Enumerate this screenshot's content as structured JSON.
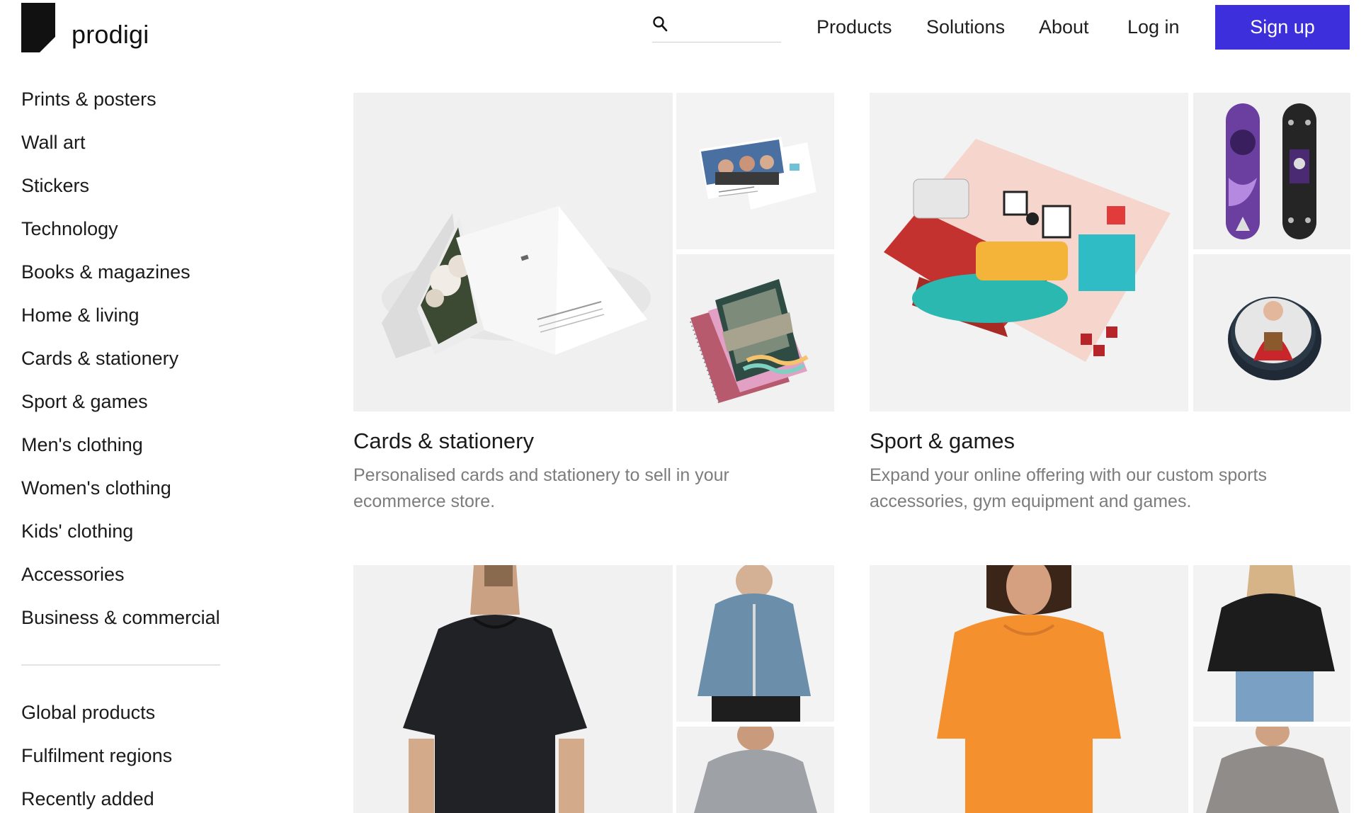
{
  "header": {
    "logo_text": "prodigi",
    "search": {
      "placeholder": "",
      "value": ""
    },
    "nav": {
      "products": "Products",
      "solutions": "Solutions",
      "about": "About",
      "login": "Log in"
    },
    "signup_label": "Sign up",
    "colors": {
      "signup_bg": "#3d2fdb"
    }
  },
  "sidebar": {
    "items": [
      {
        "label": "Prints & posters"
      },
      {
        "label": "Wall art"
      },
      {
        "label": "Stickers"
      },
      {
        "label": "Technology"
      },
      {
        "label": "Books & magazines"
      },
      {
        "label": "Home & living"
      },
      {
        "label": "Cards & stationery"
      },
      {
        "label": "Sport & games"
      },
      {
        "label": "Men's clothing"
      },
      {
        "label": "Women's clothing"
      },
      {
        "label": "Kids' clothing"
      },
      {
        "label": "Accessories"
      },
      {
        "label": "Business & commercial"
      }
    ],
    "secondary": [
      {
        "label": "Global products"
      },
      {
        "label": "Fulfilment regions"
      },
      {
        "label": "Recently added"
      }
    ]
  },
  "cards": [
    {
      "title": "Cards & stationery",
      "description": "Personalised cards and stationery to sell in your ecommerce store."
    },
    {
      "title": "Sport & games",
      "description": "Expand your online offering with our custom sports accessories, gym equipment and games."
    },
    {
      "title": "",
      "description": ""
    },
    {
      "title": "",
      "description": ""
    }
  ]
}
